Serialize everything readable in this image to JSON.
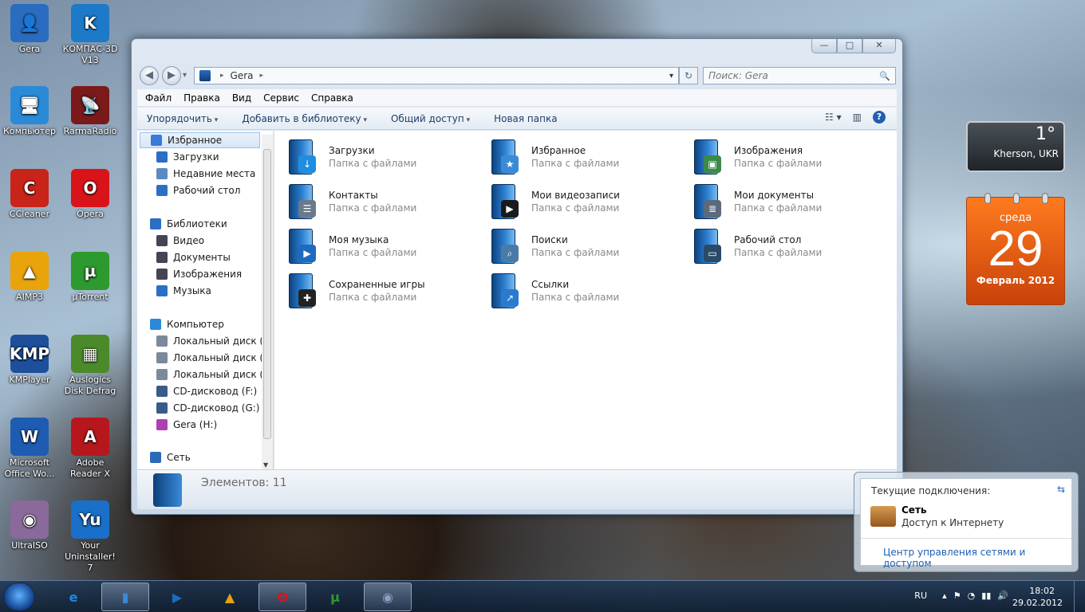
{
  "desktop_icons": [
    {
      "label": "Gera",
      "glyph": "👤",
      "color": "#2a6cc0"
    },
    {
      "label": "КОМПАС-3D V13",
      "glyph": "K",
      "color": "#1c7ac8"
    },
    {
      "label": "Компьютер",
      "glyph": "🖥",
      "color": "#2a8ad8"
    },
    {
      "label": "RarmaRadio",
      "glyph": "📡",
      "color": "#7a1a1a"
    },
    {
      "label": "CCleaner",
      "glyph": "C",
      "color": "#c9241a"
    },
    {
      "label": "Opera",
      "glyph": "O",
      "color": "#d8141a"
    },
    {
      "label": "AIMP3",
      "glyph": "▲",
      "color": "#e8a40a"
    },
    {
      "label": "µTorrent",
      "glyph": "µ",
      "color": "#2c9a2e"
    },
    {
      "label": "KMPlayer",
      "glyph": "KMP",
      "color": "#1d4f9a"
    },
    {
      "label": "Auslogics Disk Defrag",
      "glyph": "▦",
      "color": "#4a8a2a"
    },
    {
      "label": "Microsoft Office Wo...",
      "glyph": "W",
      "color": "#1e5cb3"
    },
    {
      "label": "Adobe Reader X",
      "glyph": "A",
      "color": "#b6171c"
    },
    {
      "label": "UltraISO",
      "glyph": "◉",
      "color": "#8a6a9a"
    },
    {
      "label": "Your Uninstaller! 7",
      "glyph": "Yu",
      "color": "#1a70c8"
    }
  ],
  "window": {
    "caption_buttons": {
      "minimize": "—",
      "maximize": "□",
      "close": "✕"
    },
    "nav": {
      "back": "◀",
      "forward": "▶",
      "dropdown": "▾"
    },
    "address": {
      "location": "Gera",
      "arrow": "▸",
      "dropdown": "▾"
    },
    "refresh": "↻",
    "search": {
      "placeholder": "Поиск: Gera",
      "icon": "🔍"
    },
    "menu": [
      "Файл",
      "Правка",
      "Вид",
      "Сервис",
      "Справка"
    ],
    "commands": [
      "Упорядочить",
      "Добавить в библиотеку",
      "Общий доступ"
    ],
    "new_folder": "Новая папка",
    "view_icon": "☷ ▾",
    "pane_icon": "▥",
    "help": "?",
    "nav_pane": {
      "items": [
        {
          "label": "Избранное",
          "color": "#3a7ad8",
          "selected": true
        },
        {
          "label": "Загрузки",
          "color": "#2b6fc4"
        },
        {
          "label": "Недавние места",
          "color": "#5a8ac0"
        },
        {
          "label": "Рабочий стол",
          "color": "#2b6fc4"
        },
        {
          "label": "Библиотеки",
          "color": "#2b6fc4"
        },
        {
          "label": "Видео",
          "color": "#445"
        },
        {
          "label": "Документы",
          "color": "#445"
        },
        {
          "label": "Изображения",
          "color": "#445"
        },
        {
          "label": "Музыка",
          "color": "#2b6fc4"
        },
        {
          "label": "Компьютер",
          "color": "#2a8ad8"
        },
        {
          "label": "Локальный диск (C",
          "color": "#7a8a9a"
        },
        {
          "label": "Локальный диск (D",
          "color": "#7a8a9a"
        },
        {
          "label": "Локальный диск (E",
          "color": "#7a8a9a"
        },
        {
          "label": "CD-дисковод (F:)",
          "color": "#3a5a8a"
        },
        {
          "label": "CD-дисковод (G:)",
          "color": "#3a5a8a"
        },
        {
          "label": "Gera (H:)",
          "color": "#b040b0"
        },
        {
          "label": "Сеть",
          "color": "#2a6ab8"
        }
      ]
    },
    "files": [
      {
        "name": "Загрузки",
        "type": "Папка с файлами",
        "emblem": "↓",
        "emblem_color": "#1f8ee0"
      },
      {
        "name": "Избранное",
        "type": "Папка с файлами",
        "emblem": "★",
        "emblem_color": "#3a8ad8"
      },
      {
        "name": "Изображения",
        "type": "Папка с файлами",
        "emblem": "▣",
        "emblem_color": "#3a8a4a"
      },
      {
        "name": "Контакты",
        "type": "Папка с файлами",
        "emblem": "☰",
        "emblem_color": "#6a7a8a"
      },
      {
        "name": "Мои видеозаписи",
        "type": "Папка с файлами",
        "emblem": "▶",
        "emblem_color": "#1a1a1a"
      },
      {
        "name": "Мои документы",
        "type": "Папка с файлами",
        "emblem": "≣",
        "emblem_color": "#5a6a7a"
      },
      {
        "name": "Моя музыка",
        "type": "Папка с файлами",
        "emblem": "▶",
        "emblem_color": "#1e6ac0"
      },
      {
        "name": "Поиски",
        "type": "Папка с файлами",
        "emblem": "⌕",
        "emblem_color": "#4a7aa8"
      },
      {
        "name": "Рабочий стол",
        "type": "Папка с файлами",
        "emblem": "▭",
        "emblem_color": "#2a4a6a"
      },
      {
        "name": "Сохраненные игры",
        "type": "Папка с файлами",
        "emblem": "✚",
        "emblem_color": "#222"
      },
      {
        "name": "Ссылки",
        "type": "Папка с файлами",
        "emblem": "↗",
        "emblem_color": "#2a7ad0"
      }
    ],
    "status": "Элементов: 11"
  },
  "gadgets": {
    "weather": {
      "temp": "1°",
      "city": "Kherson, UKR"
    },
    "calendar": {
      "weekday": "среда",
      "day": "29",
      "month_year": "Февраль 2012"
    }
  },
  "network_popup": {
    "header": "Текущие подключения:",
    "refresh_icon": "⇆",
    "network_name": "Сеть",
    "network_access": "Доступ к Интернету",
    "link": "Центр управления сетями и доступом"
  },
  "taskbar": {
    "items": [
      {
        "name": "ie",
        "glyph": "e",
        "color": "#1e88e5",
        "active": false
      },
      {
        "name": "explorer",
        "glyph": "▮",
        "color": "#3a8ad8",
        "active": true
      },
      {
        "name": "media-player",
        "glyph": "▶",
        "color": "#1e6ac0",
        "active": false
      },
      {
        "name": "aimp",
        "glyph": "▲",
        "color": "#e8a40a",
        "active": false
      },
      {
        "name": "opera",
        "glyph": "O",
        "color": "#d8141a",
        "active": true
      },
      {
        "name": "utorrent",
        "glyph": "µ",
        "color": "#2c9a2e",
        "active": false
      },
      {
        "name": "webcam",
        "glyph": "◉",
        "color": "#8aa0c0",
        "active": true
      }
    ],
    "tray": {
      "lang": "RU",
      "time": "18:02",
      "date": "29.02.2012",
      "icons": [
        "▴",
        "⚑",
        "◔",
        "▮▮",
        "🔊"
      ]
    }
  }
}
